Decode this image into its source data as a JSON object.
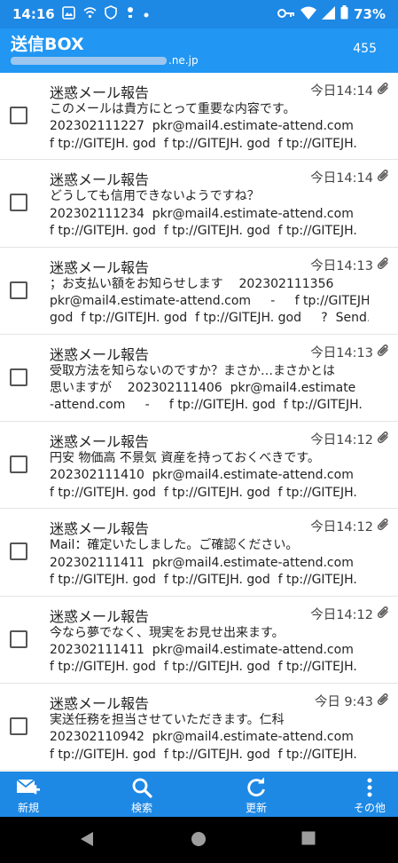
{
  "status_bar": {
    "time": "14:16",
    "battery": "73%"
  },
  "header": {
    "title": "送信BOX",
    "email_visible_suffix": ".ne.jp",
    "count": "455"
  },
  "messages": [
    {
      "subject": "迷惑メール報告",
      "date": "今日14:14",
      "has_attachment": true,
      "preview": "このメールは貴方にとって重要な内容です。\n202302111227  pkr@mail4.estimate-attend.com     -\nf tp://GITEJH. god  f tp://GITEJH. god  f tp://GITEJH. "
    },
    {
      "subject": "迷惑メール報告",
      "date": "今日14:14",
      "has_attachment": true,
      "preview": "どうしても信用できないようですね？\n202302111234  pkr@mail4.estimate-attend.com     -\nf tp://GITEJH. god  f tp://GITEJH. god  f tp://GITEJH. "
    },
    {
      "subject": "迷惑メール報告",
      "date": "今日14:13",
      "has_attachment": true,
      "preview": "；お支払い額をお知らせします    202302111356\npkr@mail4.estimate-attend.com     -     f tp://GITEJH.\ngod  f tp://GITEJH. god  f tp://GITEJH. god     ?  Send…"
    },
    {
      "subject": "迷惑メール報告",
      "date": "今日14:13",
      "has_attachment": true,
      "preview": "受取方法を知らないのですか？まさか…まさかとは\n思いますが    202302111406  pkr@mail4.estimate\n-attend.com     -     f tp://GITEJH. god  f tp://GITEJH. "
    },
    {
      "subject": "迷惑メール報告",
      "date": "今日14:12",
      "has_attachment": true,
      "preview": "円安 物価高 不景気 資産を持っておくべきです。\n202302111410  pkr@mail4.estimate-attend.com     -\nf tp://GITEJH. god  f tp://GITEJH. god  f tp://GITEJH. "
    },
    {
      "subject": "迷惑メール報告",
      "date": "今日14:12",
      "has_attachment": true,
      "preview": "Mail：確定いたしました。ご確認ください。\n202302111411  pkr@mail4.estimate-attend.com     -\nf tp://GITEJH. god  f tp://GITEJH. god  f tp://GITEJH. "
    },
    {
      "subject": "迷惑メール報告",
      "date": "今日14:12",
      "has_attachment": true,
      "preview": "今なら夢でなく、現実をお見せ出来ます。\n202302111411  pkr@mail4.estimate-attend.com     -\nf tp://GITEJH. god  f tp://GITEJH. god  f tp://GITEJH. "
    },
    {
      "subject": "迷惑メール報告",
      "date": "今日 9:43",
      "has_attachment": true,
      "preview": "実送任務を担当させていただきます。仁科\n202302110942  pkr@mail4.estimate-attend.com     -\nf tp://GITEJH. god  f tp://GITEJH. god  f tp://GITEJH. "
    }
  ],
  "toolbar": {
    "new_label": "新規",
    "search_label": "検索",
    "refresh_label": "更新",
    "more_label": "その他"
  },
  "colors": {
    "status_bar": "#1e88e5",
    "header": "#2196f3",
    "toolbar": "#1e88e5",
    "nav_bar": "#000000"
  },
  "icons": {
    "toolbar": [
      "compose-icon",
      "search-icon",
      "refresh-icon",
      "more-icon"
    ],
    "navigation": [
      "back-icon",
      "home-icon",
      "recents-icon"
    ],
    "row": [
      "checkbox",
      "paperclip-icon"
    ]
  }
}
